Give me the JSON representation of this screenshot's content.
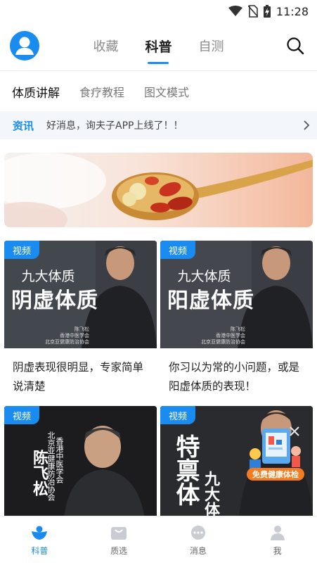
{
  "status_bar": {
    "time": "11:28"
  },
  "header": {
    "tabs": [
      {
        "label": "收藏",
        "active": false
      },
      {
        "label": "科普",
        "active": true
      },
      {
        "label": "自测",
        "active": false
      }
    ]
  },
  "sub_tabs": [
    {
      "label": "体质讲解",
      "active": true
    },
    {
      "label": "食疗教程",
      "active": false
    },
    {
      "label": "图文模式",
      "active": false
    }
  ],
  "notice": {
    "tag": "资讯",
    "text": "好消息，询夫子APP上线了！！"
  },
  "cards": [
    {
      "tag": "视频",
      "thumb_line1": "九大体质",
      "thumb_line2": "阴虚体质",
      "caption": [
        "陈飞松",
        "香港中医学会",
        "北京亚健康防治协会"
      ],
      "title": "阴虚表现很明显，专家简单说清楚"
    },
    {
      "tag": "视频",
      "thumb_line1": "九大体质",
      "thumb_line2": "阳虚体质",
      "caption": [
        "陈飞松",
        "香港中医学会",
        "北京亚健康防治协会"
      ],
      "title": "你习以为常的小问题，或是阳虚体质的表现！"
    },
    {
      "tag": "视频",
      "vert_name": "陈飞松",
      "vert_org1": "香港中医学会",
      "vert_org2": "北京亚健康防治协会"
    },
    {
      "tag": "视频",
      "vert_big": "特禀体",
      "vert_small": "九大体"
    }
  ],
  "float_ad": {
    "label": "免费健康体检"
  },
  "bottom_nav": [
    {
      "label": "科普",
      "active": true
    },
    {
      "label": "质选",
      "active": false
    },
    {
      "label": "消息",
      "active": false
    },
    {
      "label": "我",
      "active": false
    }
  ],
  "colors": {
    "accent": "#1a8cef",
    "notice_bg": "#f3f7fc"
  }
}
